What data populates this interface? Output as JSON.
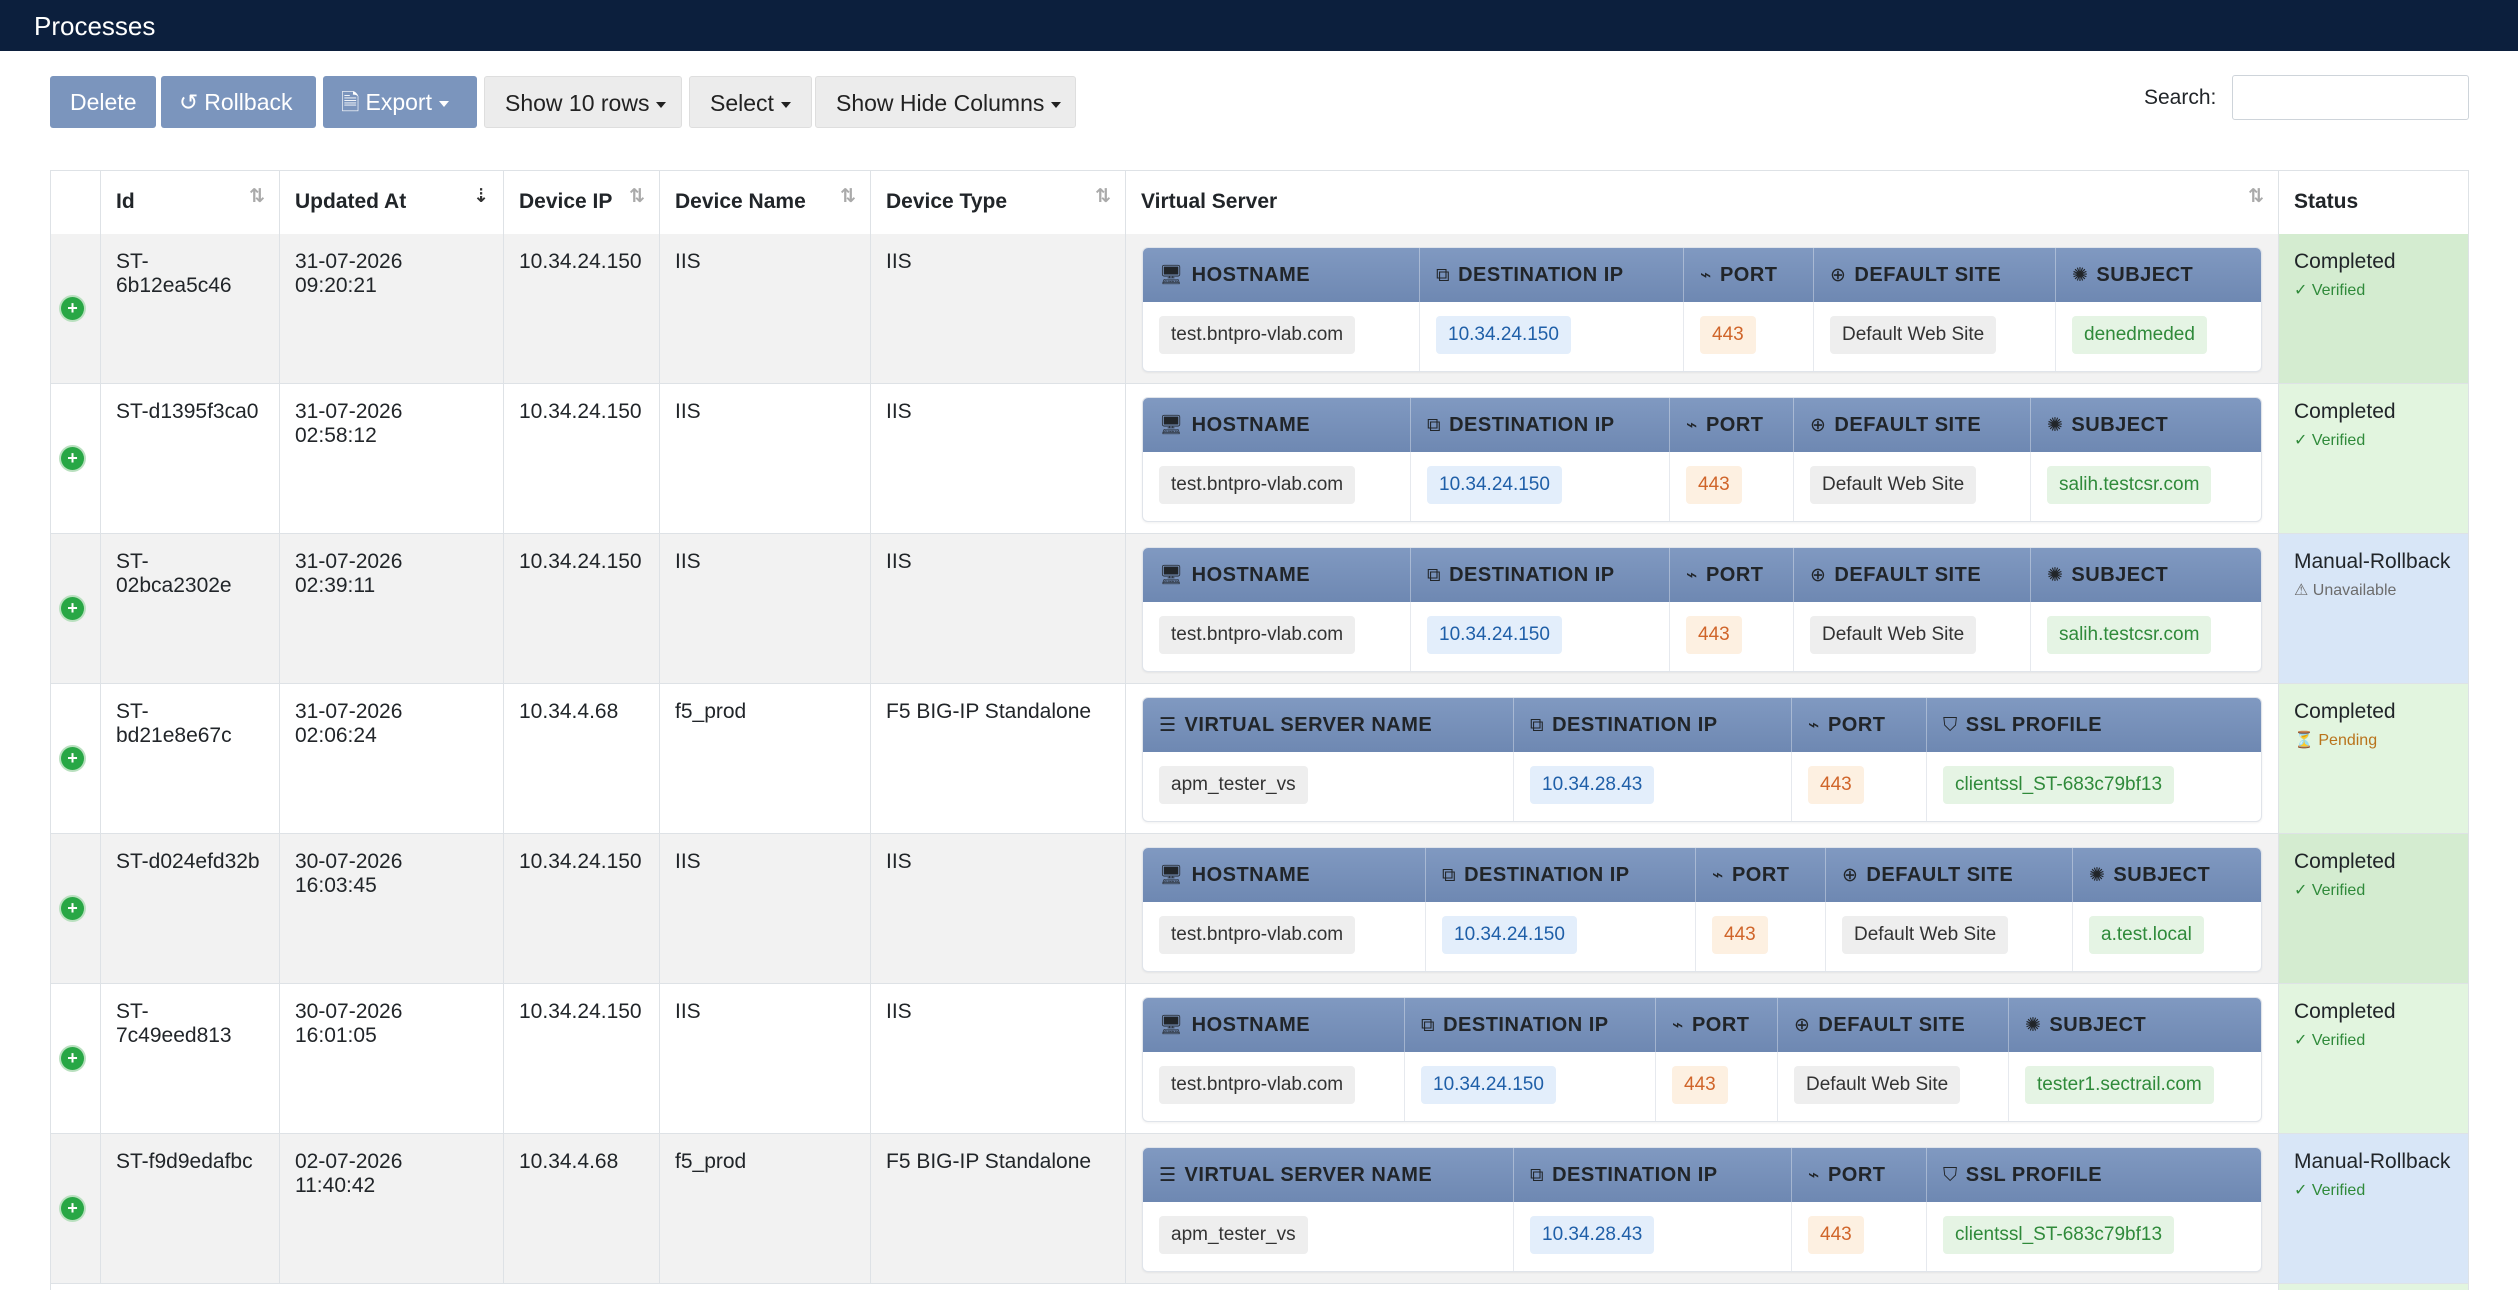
{
  "header": {
    "title": "Processes"
  },
  "toolbar": {
    "delete_label": "Delete",
    "rollback_label": "Rollback",
    "export_label": "Export",
    "rows_label": "Show 10 rows",
    "select_label": "Select",
    "columns_label": "Show Hide Columns",
    "search_label": "Search:",
    "search_value": ""
  },
  "table": {
    "columns": [
      "Id",
      "Updated At",
      "Device IP",
      "Device Name",
      "Device Type",
      "Virtual Server",
      "Status"
    ],
    "rows": [
      {
        "id": "ST-6b12ea5c46",
        "updated_at": "31-07-2026 09:20:21",
        "device_ip": "10.34.24.150",
        "device_name": "IIS",
        "device_type": "IIS",
        "vs_headers": [
          "HOSTNAME",
          "DESTINATION IP",
          "PORT",
          "DEFAULT SITE",
          "SUBJECT"
        ],
        "vs_values": [
          "test.bntpro-vlab.com",
          "10.34.24.150",
          "443",
          "Default Web Site",
          "denedmeded"
        ],
        "status": "Completed",
        "status_sub": "✓ Verified",
        "status_kind": "completed"
      },
      {
        "id": "ST-d1395f3ca0",
        "updated_at": "31-07-2026 02:58:12",
        "device_ip": "10.34.24.150",
        "device_name": "IIS",
        "device_type": "IIS",
        "vs_headers": [
          "HOSTNAME",
          "DESTINATION IP",
          "PORT",
          "DEFAULT SITE",
          "SUBJECT"
        ],
        "vs_values": [
          "test.bntpro-vlab.com",
          "10.34.24.150",
          "443",
          "Default Web Site",
          "salih.testcsr.com"
        ],
        "status": "Completed",
        "status_sub": "✓ Verified",
        "status_kind": "completed"
      },
      {
        "id": "ST-02bca2302e",
        "updated_at": "31-07-2026 02:39:11",
        "device_ip": "10.34.24.150",
        "device_name": "IIS",
        "device_type": "IIS",
        "vs_headers": [
          "HOSTNAME",
          "DESTINATION IP",
          "PORT",
          "DEFAULT SITE",
          "SUBJECT"
        ],
        "vs_values": [
          "test.bntpro-vlab.com",
          "10.34.24.150",
          "443",
          "Default Web Site",
          "salih.testcsr.com"
        ],
        "status": "Manual-Rollback",
        "status_sub": "⚠ Unavailable",
        "status_kind": "rollback"
      },
      {
        "id": "ST-bd21e8e67c",
        "updated_at": "31-07-2026 02:06:24",
        "device_ip": "10.34.4.68",
        "device_name": "f5_prod",
        "device_type": "F5 BIG-IP Standalone",
        "vs_headers": [
          "VIRTUAL SERVER NAME",
          "DESTINATION IP",
          "PORT",
          "SSL PROFILE"
        ],
        "vs_values": [
          "apm_tester_vs",
          "10.34.28.43",
          "443",
          "clientssl_ST-683c79bf13"
        ],
        "status": "Completed",
        "status_sub": "⏳ Pending",
        "status_kind": "completed"
      },
      {
        "id": "ST-d024efd32b",
        "updated_at": "30-07-2026 16:03:45",
        "device_ip": "10.34.24.150",
        "device_name": "IIS",
        "device_type": "IIS",
        "vs_headers": [
          "HOSTNAME",
          "DESTINATION IP",
          "PORT",
          "DEFAULT SITE",
          "SUBJECT"
        ],
        "vs_values": [
          "test.bntpro-vlab.com",
          "10.34.24.150",
          "443",
          "Default Web Site",
          "a.test.local"
        ],
        "status": "Completed",
        "status_sub": "✓ Verified",
        "status_kind": "completed"
      },
      {
        "id": "ST-7c49eed813",
        "updated_at": "30-07-2026 16:01:05",
        "device_ip": "10.34.24.150",
        "device_name": "IIS",
        "device_type": "IIS",
        "vs_headers": [
          "HOSTNAME",
          "DESTINATION IP",
          "PORT",
          "DEFAULT SITE",
          "SUBJECT"
        ],
        "vs_values": [
          "test.bntpro-vlab.com",
          "10.34.24.150",
          "443",
          "Default Web Site",
          "tester1.sectrail.com"
        ],
        "status": "Completed",
        "status_sub": "✓ Verified",
        "status_kind": "completed"
      },
      {
        "id": "ST-f9d9edafbc",
        "updated_at": "02-07-2026 11:40:42",
        "device_ip": "10.34.4.68",
        "device_name": "f5_prod",
        "device_type": "F5 BIG-IP Standalone",
        "vs_headers": [
          "VIRTUAL SERVER NAME",
          "DESTINATION IP",
          "PORT",
          "SSL PROFILE"
        ],
        "vs_values": [
          "apm_tester_vs",
          "10.34.28.43",
          "443",
          "clientssl_ST-683c79bf13"
        ],
        "status": "Manual-Rollback",
        "status_sub": "✓ Verified",
        "status_kind": "rollback"
      }
    ]
  },
  "colors": {
    "topbar": "#0c1f3d",
    "button_blue": "#7b95bd",
    "vs_header": "#7690b9",
    "status_completed_even": "#d4ecd0",
    "status_completed_odd": "#e2f5df",
    "status_rollback": "#d8e6f7",
    "status_sub_green": "#2f8a3a",
    "status_sub_orange": "#b9731b",
    "status_sub_gray": "#6c6c6c"
  }
}
